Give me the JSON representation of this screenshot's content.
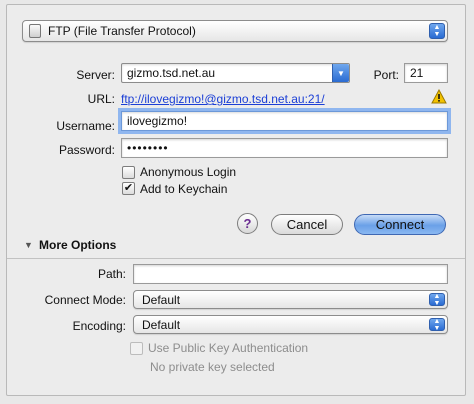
{
  "protocol": {
    "selected": "FTP (File Transfer Protocol)",
    "icon": "drive-icon"
  },
  "server": {
    "label": "Server:",
    "value": "gizmo.tsd.net.au"
  },
  "port": {
    "label": "Port:",
    "value": "21"
  },
  "url": {
    "label": "URL:",
    "value": "ftp://ilovegizmo!@gizmo.tsd.net.au:21/",
    "warning_icon": "warning-icon"
  },
  "username": {
    "label": "Username:",
    "value": "ilovegizmo!"
  },
  "password": {
    "label": "Password:",
    "value": "••••••••"
  },
  "options": {
    "anonymous_label": "Anonymous Login",
    "anonymous_checked": false,
    "keychain_label": "Add to Keychain",
    "keychain_checked": true
  },
  "buttons": {
    "help": "?",
    "cancel": "Cancel",
    "connect": "Connect"
  },
  "more_options": {
    "title": "More Options",
    "path_label": "Path:",
    "path_value": "",
    "connect_mode_label": "Connect Mode:",
    "connect_mode_value": "Default",
    "encoding_label": "Encoding:",
    "encoding_value": "Default",
    "pubkey_label": "Use Public Key Authentication",
    "pubkey_checked": false,
    "private_key_status": "No private key selected"
  },
  "colors": {
    "accent": "#2a6bd2",
    "link": "#1b3fd6",
    "warning": "#f2c200",
    "help_purple": "#6a2c91"
  }
}
